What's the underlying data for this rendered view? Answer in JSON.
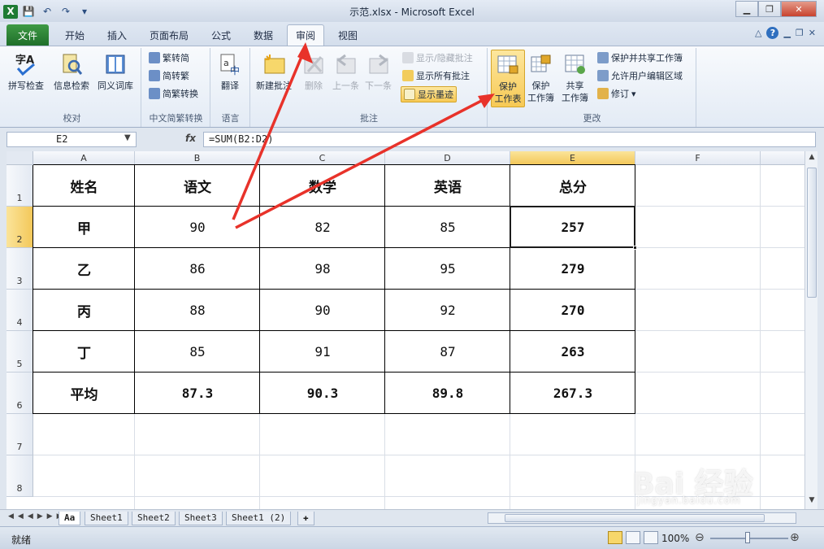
{
  "window": {
    "title": "示范.xlsx - Microsoft Excel"
  },
  "tabs": [
    "文件",
    "开始",
    "插入",
    "页面布局",
    "公式",
    "数据",
    "审阅",
    "视图"
  ],
  "ribbon": {
    "proofing": {
      "label": "校对",
      "spell": "拼写检查",
      "research": "信息检索",
      "thesaurus": "同义词库"
    },
    "chinese": {
      "label": "中文简繁转换",
      "to_simplified": "繁转简",
      "to_traditional": "简转繁",
      "convert": "简繁转换"
    },
    "language": {
      "label": "语言",
      "translate": "翻译"
    },
    "comments": {
      "label": "批注",
      "new": "新建批注",
      "delete": "删除",
      "prev": "上一条",
      "next": "下一条",
      "show_hide": "显示/隐藏批注",
      "show_all": "显示所有批注",
      "show_ink": "显示墨迹"
    },
    "changes": {
      "label": "更改",
      "protect_sheet": "保护\n工作表",
      "protect_book": "保护\n工作簿",
      "share_book": "共享\n工作簿",
      "protect_share": "保护并共享工作簿",
      "allow_edit": "允许用户编辑区域",
      "track": "修订"
    }
  },
  "formula_bar": {
    "name_box": "E2",
    "fx": "fx",
    "formula": "=SUM(B2:D2)"
  },
  "columns": [
    "A",
    "B",
    "C",
    "D",
    "E",
    "F"
  ],
  "rows": [
    "1",
    "2",
    "3",
    "4",
    "5",
    "6",
    "7",
    "8"
  ],
  "table": {
    "header": [
      "姓名",
      "语文",
      "数学",
      "英语",
      "总分"
    ],
    "body": [
      [
        "甲",
        "90",
        "82",
        "85",
        "257"
      ],
      [
        "乙",
        "86",
        "98",
        "95",
        "279"
      ],
      [
        "丙",
        "88",
        "90",
        "92",
        "270"
      ],
      [
        "丁",
        "85",
        "91",
        "87",
        "263"
      ]
    ],
    "average": [
      "平均",
      "87.3",
      "90.3",
      "89.8",
      "267.3"
    ]
  },
  "sheets": [
    "Aa",
    "Sheet1",
    "Sheet2",
    "Sheet3",
    "Sheet1 (2)"
  ],
  "status": {
    "ready": "就绪",
    "zoom": "100%"
  },
  "watermark": {
    "brand": "Bai 经验",
    "url": "jingyan.baidu.com"
  },
  "colors": {
    "file_tab": "#2a8a36",
    "selected_header": "#f3c85a",
    "arrow": "#e8322a"
  }
}
